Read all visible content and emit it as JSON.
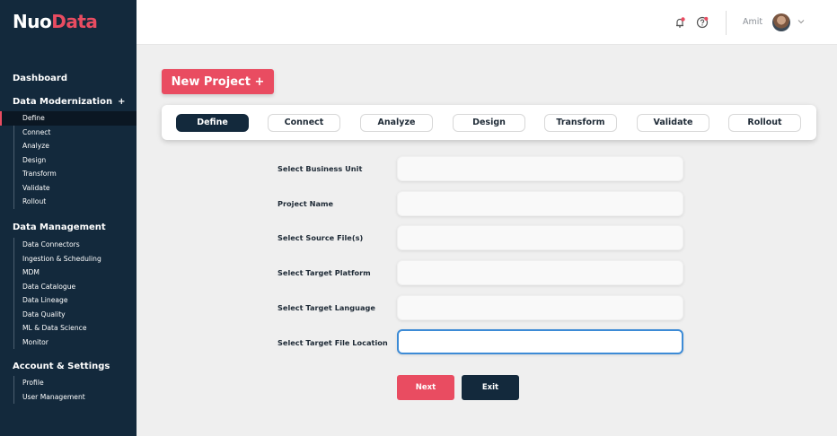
{
  "brand": {
    "part1": "Nuo",
    "part2": "Data"
  },
  "sidebar": {
    "dashboard": "Dashboard",
    "data_modernization": {
      "title": "Data Modernization",
      "plus": "+",
      "items": [
        "Define",
        "Connect",
        "Analyze",
        "Design",
        "Transform",
        "Validate",
        "Rollout"
      ]
    },
    "data_management": {
      "title": "Data Management",
      "items": [
        "Data Connectors",
        "Ingestion & Scheduling",
        "MDM",
        "Data Catalogue",
        "Data Lineage",
        "Data Quality",
        "ML & Data Science",
        "Monitor"
      ]
    },
    "account_settings": {
      "title": "Account & Settings",
      "items": [
        "Profile",
        "User Management"
      ]
    }
  },
  "header": {
    "user_name": "Amit",
    "icons": [
      "bell-icon",
      "help-icon",
      "chevron-down-icon"
    ]
  },
  "main": {
    "new_project_label": "New Project +",
    "steps": [
      "Define",
      "Connect",
      "Analyze",
      "Design",
      "Transform",
      "Validate",
      "Rollout"
    ],
    "active_step": "Define",
    "fields": [
      {
        "label": "Select Business Unit",
        "value": ""
      },
      {
        "label": "Project Name",
        "value": ""
      },
      {
        "label": "Select Source File(s)",
        "value": ""
      },
      {
        "label": "Select Target Platform",
        "value": ""
      },
      {
        "label": "Select Target Language",
        "value": ""
      },
      {
        "label": "Select Target File Location",
        "value": ""
      }
    ],
    "next_label": "Next",
    "exit_label": "Exit"
  },
  "colors": {
    "sidebar_bg": "#13293c",
    "accent": "#e94c61",
    "focus": "#3d8bd6",
    "page_bg": "#efefef"
  }
}
